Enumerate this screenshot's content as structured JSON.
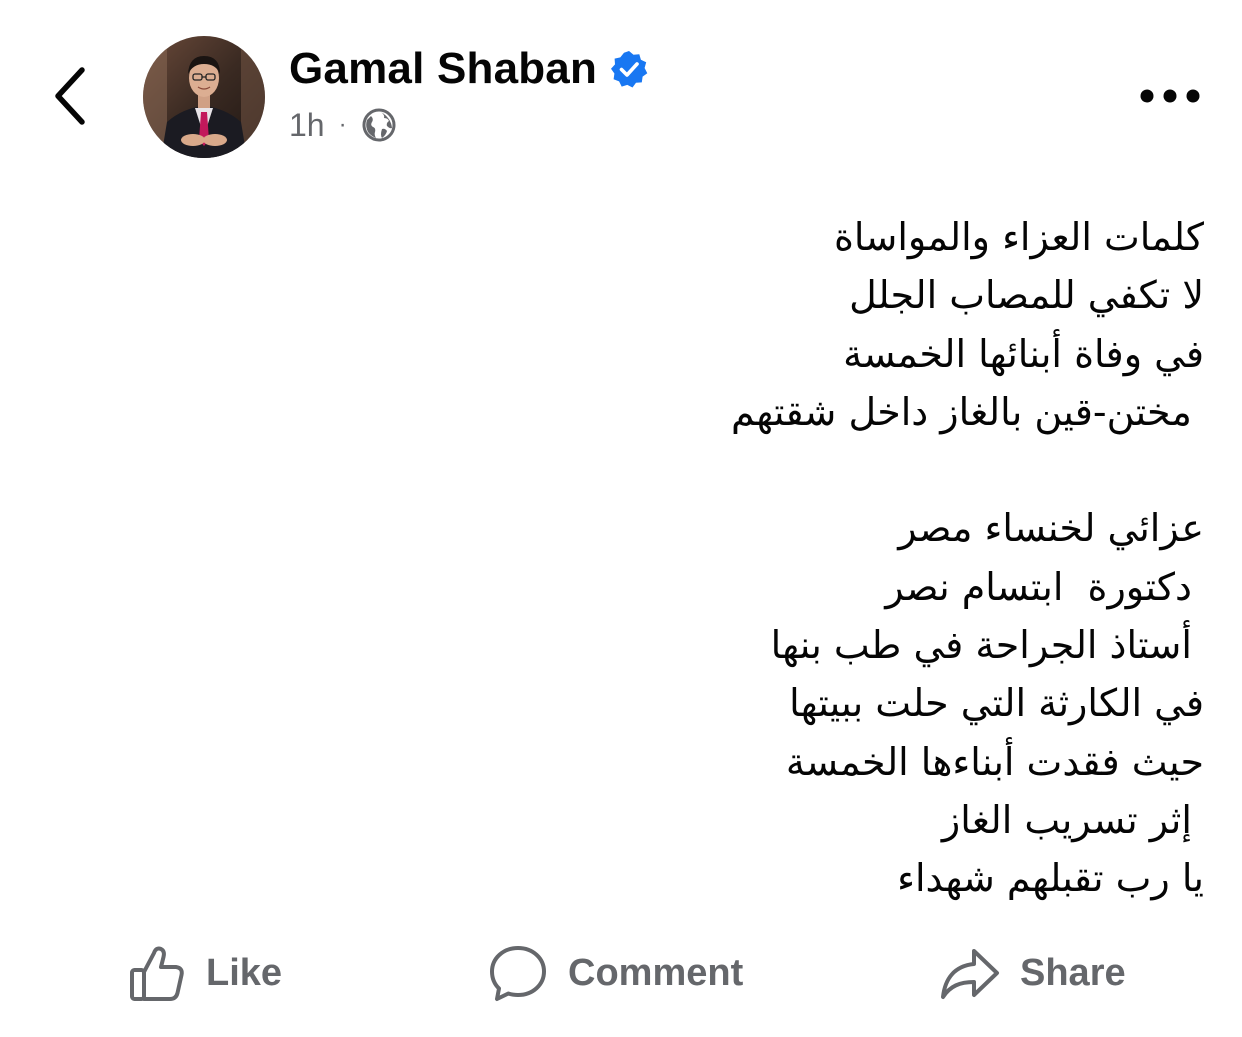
{
  "header": {
    "author_name": "Gamal Shaban",
    "timestamp": "1h",
    "separator": "·",
    "verified_color": "#1877f2",
    "icons": {
      "back": "chevron-left-icon",
      "verified": "verified-badge-icon",
      "audience": "globe-icon",
      "more": "more-horizontal-icon"
    }
  },
  "post": {
    "lines": [
      "كلمات العزاء والمواساة",
      "لا تكفي للمصاب الجلل",
      "في وفاة أبنائها الخمسة",
      " مختن-قين بالغاز داخل شقتهم",
      "",
      "عزائي لخنساء مصر",
      " دكتورة  ابتسام نصر",
      " أستاذ الجراحة في طب بنها",
      "في الكارثة التي حلت ببيتها",
      "حيث فقدت أبناءها الخمسة",
      " إثر تسريب الغاز",
      "يا رب تقبلهم شهداء"
    ]
  },
  "actions": {
    "like_label": "Like",
    "comment_label": "Comment",
    "share_label": "Share",
    "icons": {
      "like": "thumbs-up-icon",
      "comment": "comment-bubble-icon",
      "share": "share-arrow-icon"
    }
  }
}
